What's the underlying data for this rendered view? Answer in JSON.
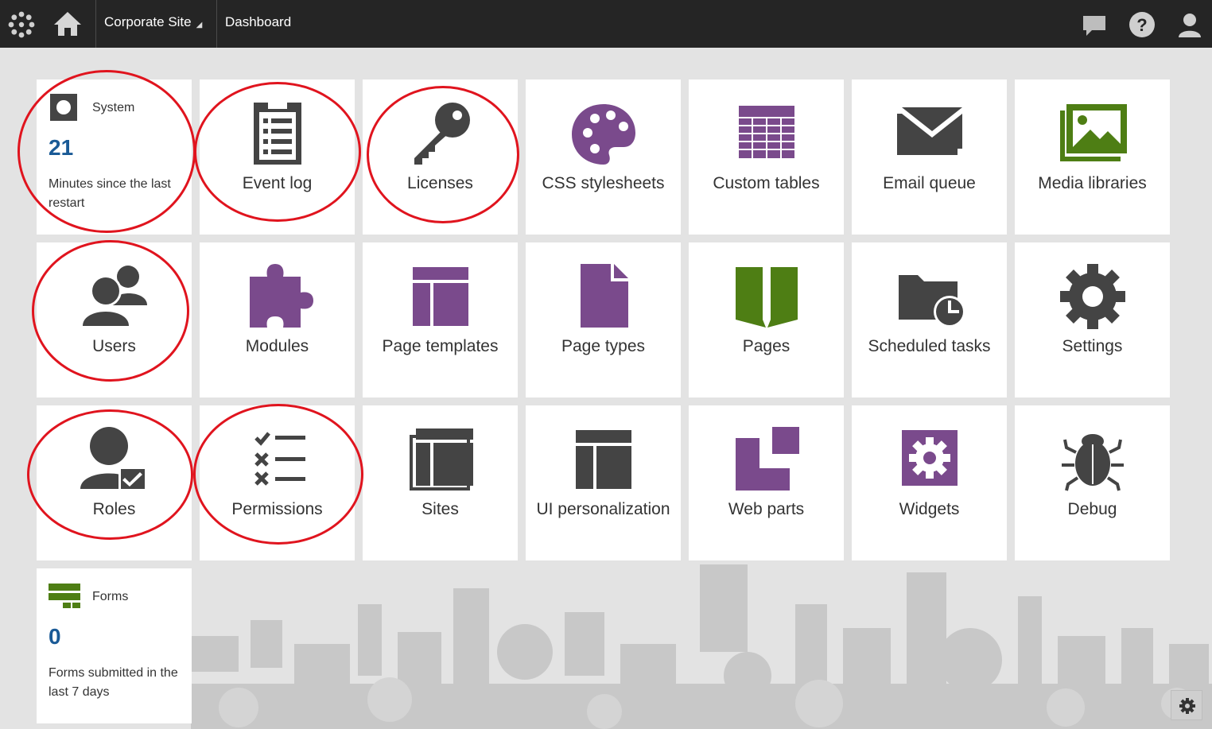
{
  "header": {
    "site_selector": "Corporate Site",
    "breadcrumb": "Dashboard"
  },
  "colors": {
    "purple": "#7a4a8c",
    "green": "#4e7e14",
    "dark": "#444444",
    "annotation_red": "#e0141e",
    "number_blue": "#1a5a96"
  },
  "live_tiles": {
    "system": {
      "title": "System",
      "value": "21",
      "description": "Minutes since the last restart",
      "icon": "system-icon"
    },
    "forms": {
      "title": "Forms",
      "value": "0",
      "description": "Forms submitted in the last 7 days",
      "icon": "forms-icon"
    }
  },
  "tiles": {
    "event_log": {
      "label": "Event log",
      "icon": "event-log-icon"
    },
    "licenses": {
      "label": "Licenses",
      "icon": "key-icon"
    },
    "css": {
      "label": "CSS stylesheets",
      "icon": "palette-icon"
    },
    "custom_tables": {
      "label": "Custom tables",
      "icon": "table-icon"
    },
    "email_queue": {
      "label": "Email queue",
      "icon": "envelope-icon"
    },
    "media": {
      "label": "Media libraries",
      "icon": "image-icon"
    },
    "users": {
      "label": "Users",
      "icon": "users-icon"
    },
    "modules": {
      "label": "Modules",
      "icon": "puzzle-icon"
    },
    "page_templates": {
      "label": "Page templates",
      "icon": "page-template-icon"
    },
    "page_types": {
      "label": "Page types",
      "icon": "document-icon"
    },
    "pages": {
      "label": "Pages",
      "icon": "book-icon"
    },
    "scheduled": {
      "label": "Scheduled tasks",
      "icon": "folder-clock-icon"
    },
    "settings": {
      "label": "Settings",
      "icon": "gear-icon"
    },
    "roles": {
      "label": "Roles",
      "icon": "role-icon"
    },
    "permissions": {
      "label": "Permissions",
      "icon": "checklist-icon"
    },
    "sites": {
      "label": "Sites",
      "icon": "sites-icon"
    },
    "ui_personalization": {
      "label": "UI personalization",
      "icon": "layout-icon"
    },
    "web_parts": {
      "label": "Web parts",
      "icon": "web-parts-icon"
    },
    "widgets": {
      "label": "Widgets",
      "icon": "widget-gear-icon"
    },
    "debug": {
      "label": "Debug",
      "icon": "bug-icon"
    }
  }
}
